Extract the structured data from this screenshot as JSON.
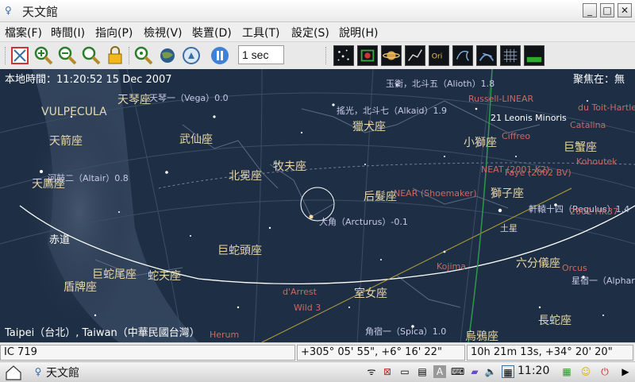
{
  "window": {
    "title": "天文館",
    "app_icon": "stellarium-icon"
  },
  "menu": [
    "檔案(F)",
    "時間(I)",
    "指向(P)",
    "檢視(V)",
    "裝置(D)",
    "工具(T)",
    "設定(S)",
    "說明(H)"
  ],
  "toolbar": {
    "time_rate": "1 sec",
    "plus": "+",
    "minus": "−"
  },
  "sky": {
    "local_time": "本地時間：11:20:52  15 Dec 2007",
    "focus": "聚焦在：無",
    "location": "Taipei（台北）, Taiwan（中華民國台灣）",
    "constellations": [
      "VULPECULA",
      "天箭座",
      "天鷹座",
      "天琴座",
      "武仙座",
      "北冕座",
      "牧夫座",
      "獵犬座",
      "小獅座",
      "巨蟹座",
      "后髮座",
      "獅子座",
      "巨蛇頭座",
      "巨蛇尾座",
      "蛇夫座",
      "盾牌座",
      "室女座",
      "六分儀座",
      "長蛇座",
      "烏鴉座"
    ],
    "equator_label": "赤道",
    "stars": [
      "天琴一（Vega）0.0",
      "河鼓二（Altair）0.8",
      "玉衡，北斗五（Alioth）1.8",
      "搖光，北斗七（Alkaid）1.9",
      "大角（Arcturus）-0.1",
      "軒轅十四（Regulus）1.4",
      "星宿一（Alphard）",
      "角宿一（Spica）1.0",
      "21 Leonis Minoris"
    ],
    "objects": [
      "Russell-LINEAR",
      "du Toit-Hartley",
      "Ciffreo",
      "NEAT (2001 K2)",
      "Catalina",
      "Kohoutek",
      "NEAR (Shoemaker)",
      "Kojima",
      "Orcus",
      "d'Arrest",
      "Wild 3",
      "Herum",
      "Faye (2002 BV)",
      "2002 HK37"
    ],
    "planet_label": "土星"
  },
  "status": {
    "object": "IC 719",
    "altaz": "+305° 05' 55\", +6° 16' 22\"",
    "radec": "10h 21m 13s, +34° 20' 20\""
  },
  "taskbar": {
    "task_label": "天文館",
    "clock": "11:20"
  },
  "colors": {
    "sky_bg": "#1e2f45",
    "constellation_label": "#e7d6a8",
    "object_label": "#c86a62"
  }
}
